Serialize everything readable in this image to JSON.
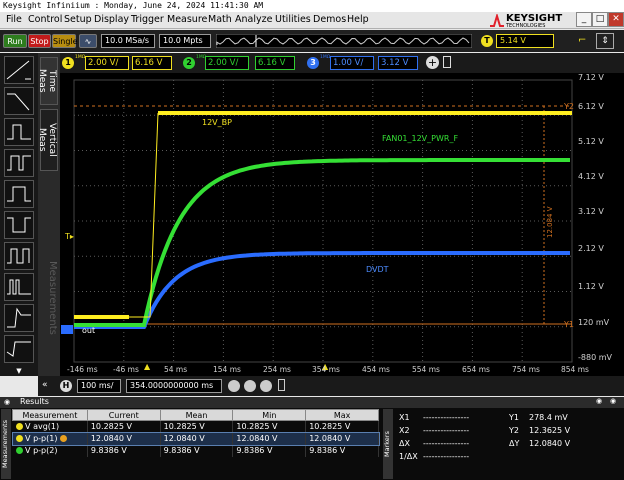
{
  "window_title": "Keysight Infiniium : Monday, June 24, 2024 11:41:30 AM",
  "menu": [
    "File",
    "Control",
    "Setup",
    "Display",
    "Trigger",
    "Measure",
    "Math",
    "Analyze",
    "Utilities",
    "Demos",
    "Help"
  ],
  "brand": {
    "name": "KEYSIGHT",
    "sub": "TECHNOLOGIES"
  },
  "toolbar": {
    "run": "Run",
    "stop": "Stop",
    "single": "Single",
    "sample_rate": "10.0 MSa/s",
    "memory": "10.0 Mpts",
    "trigger_level": "5.14 V",
    "trigger_badge": "T"
  },
  "channels": [
    {
      "num": "1",
      "imp": "1MΩ",
      "scale": "2.00 V/",
      "offset": "6.16 V",
      "color": "#f0e020"
    },
    {
      "num": "2",
      "imp": "1MΩ",
      "scale": "2.00 V/",
      "offset": "6.16 V",
      "color": "#30d030"
    },
    {
      "num": "3",
      "imp": "1MΩ",
      "scale": "1.00 V/",
      "offset": "3.12 V",
      "color": "#3070f0"
    }
  ],
  "tabs": {
    "time_meas": "Time Meas",
    "vertical_meas": "Vertical Meas",
    "measurements": "Measurements"
  },
  "y_labels": [
    "7.12 V",
    "6.12 V",
    "5.12 V",
    "4.12 V",
    "3.12 V",
    "2.12 V",
    "1.12 V",
    "120 mV",
    "-880 mV"
  ],
  "x_labels": [
    "-146 ms",
    "-46 ms",
    "54 ms",
    "154 ms",
    "254 ms",
    "354 ms",
    "454 ms",
    "554 ms",
    "654 ms",
    "754 ms",
    "854 ms"
  ],
  "waveform_labels": {
    "ch1": "12V_BP",
    "ch2": "FAN01_12V_PWR_F",
    "ch3": "DVDT",
    "out": "out",
    "y2": "Y2",
    "y1": "Y1",
    "delta": "12.084 V"
  },
  "horizontal": {
    "badge": "H",
    "scale": "100 ms/",
    "position": "354.0000000000 ms"
  },
  "results": {
    "title": "Results",
    "side_label": "Measurements",
    "headers": [
      "Measurement",
      "Current",
      "Mean",
      "Min",
      "Max"
    ],
    "rows": [
      {
        "name": "V avg(1)",
        "current": "10.2825 V",
        "mean": "10.2825 V",
        "min": "10.2825 V",
        "max": "10.2825 V",
        "color": "#f0e020"
      },
      {
        "name": "V p-p(1)",
        "current": "12.0840 V",
        "mean": "12.0840 V",
        "min": "12.0840 V",
        "max": "12.0840 V",
        "color": "#f0e020"
      },
      {
        "name": "V p-p(2)",
        "current": "9.8386 V",
        "mean": "9.8386 V",
        "min": "9.8386 V",
        "max": "9.8386 V",
        "color": "#30d030"
      }
    ]
  },
  "markers": {
    "side_label": "Markers",
    "x1_label": "X1",
    "x1_value": "----------------",
    "x2_label": "X2",
    "x2_value": "----------------",
    "dx_label": "ΔX",
    "dx_value": "----------------",
    "inv_label": "1/ΔX",
    "inv_value": "----------------",
    "y1_label": "Y1",
    "y1_value": "278.4 mV",
    "y2_label": "Y2",
    "y2_value": "12.3625 V",
    "dy_label": "ΔY",
    "dy_value": "12.0840 V"
  }
}
